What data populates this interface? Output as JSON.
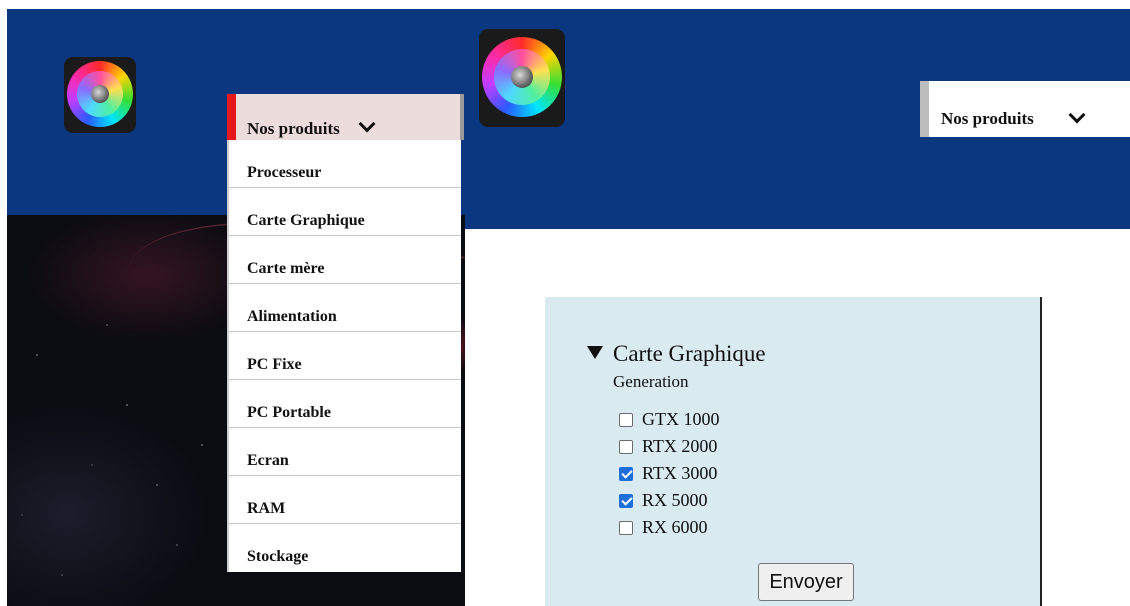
{
  "left_view": {
    "logo_icon": "rgb-fan-logo-icon",
    "nav": {
      "label": "Nos produits",
      "chevron_icon": "chevron-down-icon",
      "menu_items": [
        "Processeur",
        "Carte Graphique",
        "Carte mère",
        "Alimentation",
        "PC Fixe",
        "PC Portable",
        "Ecran",
        "RAM",
        "Stockage"
      ]
    }
  },
  "right_view": {
    "logo_icon": "rgb-fan-logo-icon",
    "nav": {
      "label": "Nos produits",
      "chevron_icon": "chevron-down-icon"
    },
    "filter": {
      "summary": "Carte Graphique",
      "group_label": "Generation",
      "options": [
        {
          "label": "GTX 1000",
          "checked": false
        },
        {
          "label": "RTX 2000",
          "checked": false
        },
        {
          "label": "RTX 3000",
          "checked": true
        },
        {
          "label": "RX 5000",
          "checked": true
        },
        {
          "label": "RX 6000",
          "checked": false
        }
      ],
      "submit_label": "Envoyer"
    }
  },
  "colors": {
    "header_blue": "#0a3780",
    "active_red": "#e61a1a",
    "checkbox_blue": "#1f6fdb",
    "filter_panel_bg": "#daeaf1"
  }
}
